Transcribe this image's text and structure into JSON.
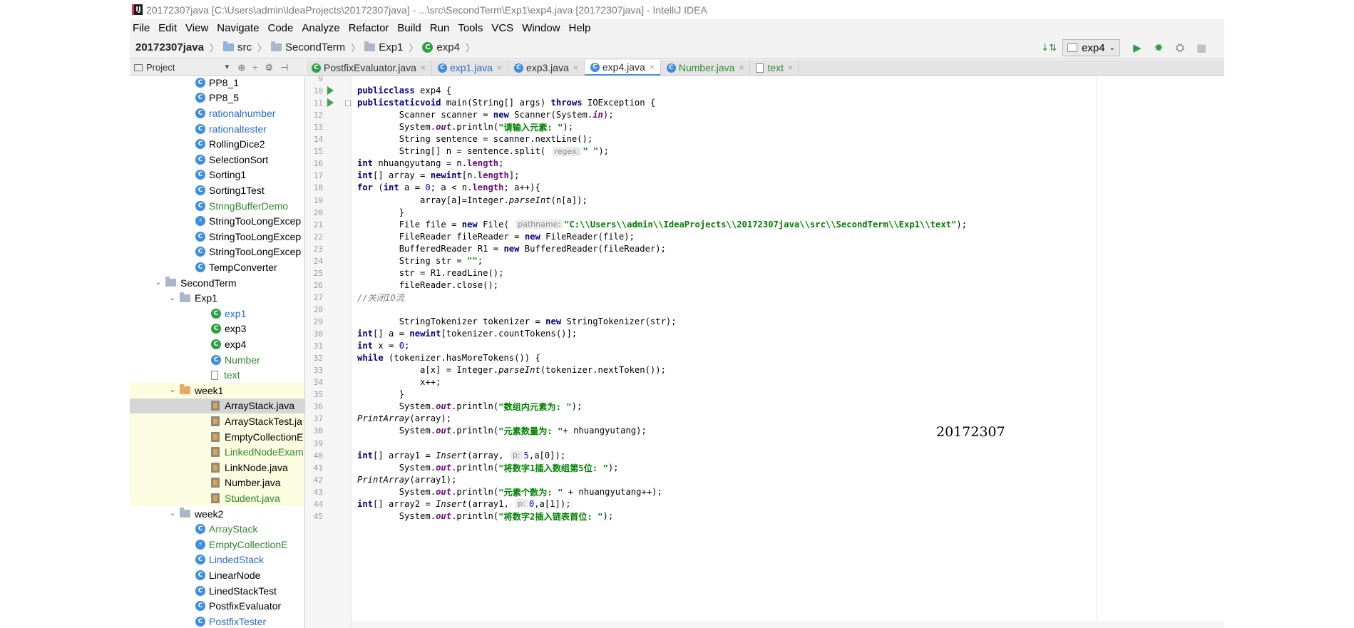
{
  "window": {
    "title": "20172307java [C:\\Users\\admin\\IdeaProjects\\20172307java] - ...\\src\\SecondTerm\\Exp1\\exp4.java [20172307java] - IntelliJ IDEA"
  },
  "menu": [
    "File",
    "Edit",
    "View",
    "Navigate",
    "Code",
    "Analyze",
    "Refactor",
    "Build",
    "Run",
    "Tools",
    "VCS",
    "Window",
    "Help"
  ],
  "breadcrumb": [
    "20172307java",
    "src",
    "SecondTerm",
    "Exp1",
    "exp4"
  ],
  "run_config": {
    "name": "exp4"
  },
  "project_panel": {
    "label": "Project"
  },
  "tabs": [
    {
      "label": "PostfixEvaluator.java",
      "icon": "java-file-icon",
      "color": "default"
    },
    {
      "label": "exp1.java",
      "icon": "class-icon",
      "color": "blue"
    },
    {
      "label": "exp3.java",
      "icon": "class-icon",
      "color": "default"
    },
    {
      "label": "exp4.java",
      "icon": "class-icon",
      "color": "default",
      "active": true
    },
    {
      "label": "Number.java",
      "icon": "class-icon",
      "color": "green"
    },
    {
      "label": "text",
      "icon": "text-file-icon",
      "color": "green"
    }
  ],
  "tree": [
    {
      "label": "PP8_1",
      "icon": "class",
      "color": "default"
    },
    {
      "label": "PP8_5",
      "icon": "class",
      "color": "default"
    },
    {
      "label": "rationalnumber",
      "icon": "class",
      "color": "blue"
    },
    {
      "label": "rationaltester",
      "icon": "class",
      "color": "blue"
    },
    {
      "label": "RollingDice2",
      "icon": "class",
      "color": "default"
    },
    {
      "label": "SelectionSort",
      "icon": "class",
      "color": "default"
    },
    {
      "label": "Sorting1",
      "icon": "class",
      "color": "default"
    },
    {
      "label": "Sorting1Test",
      "icon": "class",
      "color": "default"
    },
    {
      "label": "StringBufferDemo",
      "icon": "class",
      "color": "green"
    },
    {
      "label": "StringTooLongExcep",
      "icon": "exception",
      "color": "default"
    },
    {
      "label": "StringTooLongExcep",
      "icon": "class",
      "color": "default"
    },
    {
      "label": "StringTooLongExcep",
      "icon": "class",
      "color": "default"
    },
    {
      "label": "TempConverter",
      "icon": "class",
      "color": "default"
    },
    {
      "label": "SecondTerm",
      "icon": "folder",
      "color": "default"
    },
    {
      "label": "Exp1",
      "icon": "folder",
      "color": "default"
    },
    {
      "label": "exp1",
      "icon": "runnable-class",
      "color": "blue"
    },
    {
      "label": "exp3",
      "icon": "runnable-class",
      "color": "default"
    },
    {
      "label": "exp4",
      "icon": "runnable-class",
      "color": "default"
    },
    {
      "label": "Number",
      "icon": "class",
      "color": "green"
    },
    {
      "label": "text",
      "icon": "text",
      "color": "green"
    },
    {
      "label": "week1",
      "icon": "folder",
      "color": "default"
    },
    {
      "label": "ArrayStack.java",
      "icon": "java",
      "color": "default"
    },
    {
      "label": "ArrayStackTest.ja",
      "icon": "java",
      "color": "default"
    },
    {
      "label": "EmptyCollectionE",
      "icon": "java",
      "color": "default"
    },
    {
      "label": "LinkedNodeExam",
      "icon": "java",
      "color": "green"
    },
    {
      "label": "LinkNode.java",
      "icon": "java",
      "color": "default"
    },
    {
      "label": "Number.java",
      "icon": "java",
      "color": "default"
    },
    {
      "label": "Student.java",
      "icon": "java",
      "color": "green"
    },
    {
      "label": "week2",
      "icon": "folder",
      "color": "default"
    },
    {
      "label": "ArrayStack",
      "icon": "class",
      "color": "green"
    },
    {
      "label": "EmptyCollectionE",
      "icon": "exception",
      "color": "green"
    },
    {
      "label": "LindedStack",
      "icon": "class",
      "color": "blue"
    },
    {
      "label": "LinearNode",
      "icon": "class",
      "color": "default"
    },
    {
      "label": "LinedStackTest",
      "icon": "class",
      "color": "default"
    },
    {
      "label": "PostfixEvaluator",
      "icon": "class",
      "color": "default"
    },
    {
      "label": "PostfixTester",
      "icon": "class",
      "color": "blue"
    }
  ],
  "code": {
    "lines": [
      {
        "n": "9",
        "t": ""
      },
      {
        "n": "10",
        "t": "public class exp4 {"
      },
      {
        "n": "11",
        "t": "    public static void main(String[] args) throws IOException {"
      },
      {
        "n": "12",
        "t": "        Scanner scanner = new Scanner(System.in);"
      },
      {
        "n": "13",
        "t": "        System.out.println(\"请输入元素: \");"
      },
      {
        "n": "14",
        "t": "        String sentence = scanner.nextLine();"
      },
      {
        "n": "15",
        "t": "        String[] n = sentence.split( regex: \" \");"
      },
      {
        "n": "16",
        "t": "        int nhuangyutang = n.length;"
      },
      {
        "n": "17",
        "t": "        int[] array = new int[n.length];"
      },
      {
        "n": "18",
        "t": "        for (int a = 0; a < n.length; a++){"
      },
      {
        "n": "19",
        "t": "            array[a]=Integer.parseInt(n[a]);"
      },
      {
        "n": "20",
        "t": "        }"
      },
      {
        "n": "21",
        "t": "        File file = new File( pathname: \"C:\\\\Users\\\\admin\\\\IdeaProjects\\\\20172307java\\\\src\\\\SecondTerm\\\\Exp1\\\\text\");"
      },
      {
        "n": "22",
        "t": "        FileReader fileReader = new FileReader(file);"
      },
      {
        "n": "23",
        "t": "        BufferedReader R1 = new BufferedReader(fileReader);"
      },
      {
        "n": "24",
        "t": "        String str = \"\";"
      },
      {
        "n": "25",
        "t": "        str = R1.readLine();"
      },
      {
        "n": "26",
        "t": "        fileReader.close();"
      },
      {
        "n": "27",
        "t": "        //关闭IO流"
      },
      {
        "n": "28",
        "t": ""
      },
      {
        "n": "29",
        "t": "        StringTokenizer tokenizer = new StringTokenizer(str);"
      },
      {
        "n": "30",
        "t": "        int[] a = new int[tokenizer.countTokens()];"
      },
      {
        "n": "31",
        "t": "        int x = 0;"
      },
      {
        "n": "32",
        "t": "        while (tokenizer.hasMoreTokens()) {"
      },
      {
        "n": "33",
        "t": "            a[x] = Integer.parseInt(tokenizer.nextToken());"
      },
      {
        "n": "34",
        "t": "            x++;"
      },
      {
        "n": "35",
        "t": "        }"
      },
      {
        "n": "36",
        "t": "        System.out.println(\"数组内元素为: \");"
      },
      {
        "n": "37",
        "t": "        PrintArray(array);"
      },
      {
        "n": "38",
        "t": "        System.out.println(\"元素数量为: \"+ nhuangyutang);"
      },
      {
        "n": "39",
        "t": ""
      },
      {
        "n": "40",
        "t": "        int[] array1 = Insert(array, p: 5,a[0]);"
      },
      {
        "n": "41",
        "t": "        System.out.println(\"将数字1插入数组第5位: \");"
      },
      {
        "n": "42",
        "t": "        PrintArray(array1);"
      },
      {
        "n": "43",
        "t": "        System.out.println(\"元素个数为: \" + nhuangyutang++);"
      },
      {
        "n": "44",
        "t": "        int[] array2 = Insert(array1, p: 0,a[1]);"
      },
      {
        "n": "45",
        "t": "        System.out.println(\"将数字2插入链表首位: \");"
      }
    ]
  },
  "watermark": "20172307"
}
